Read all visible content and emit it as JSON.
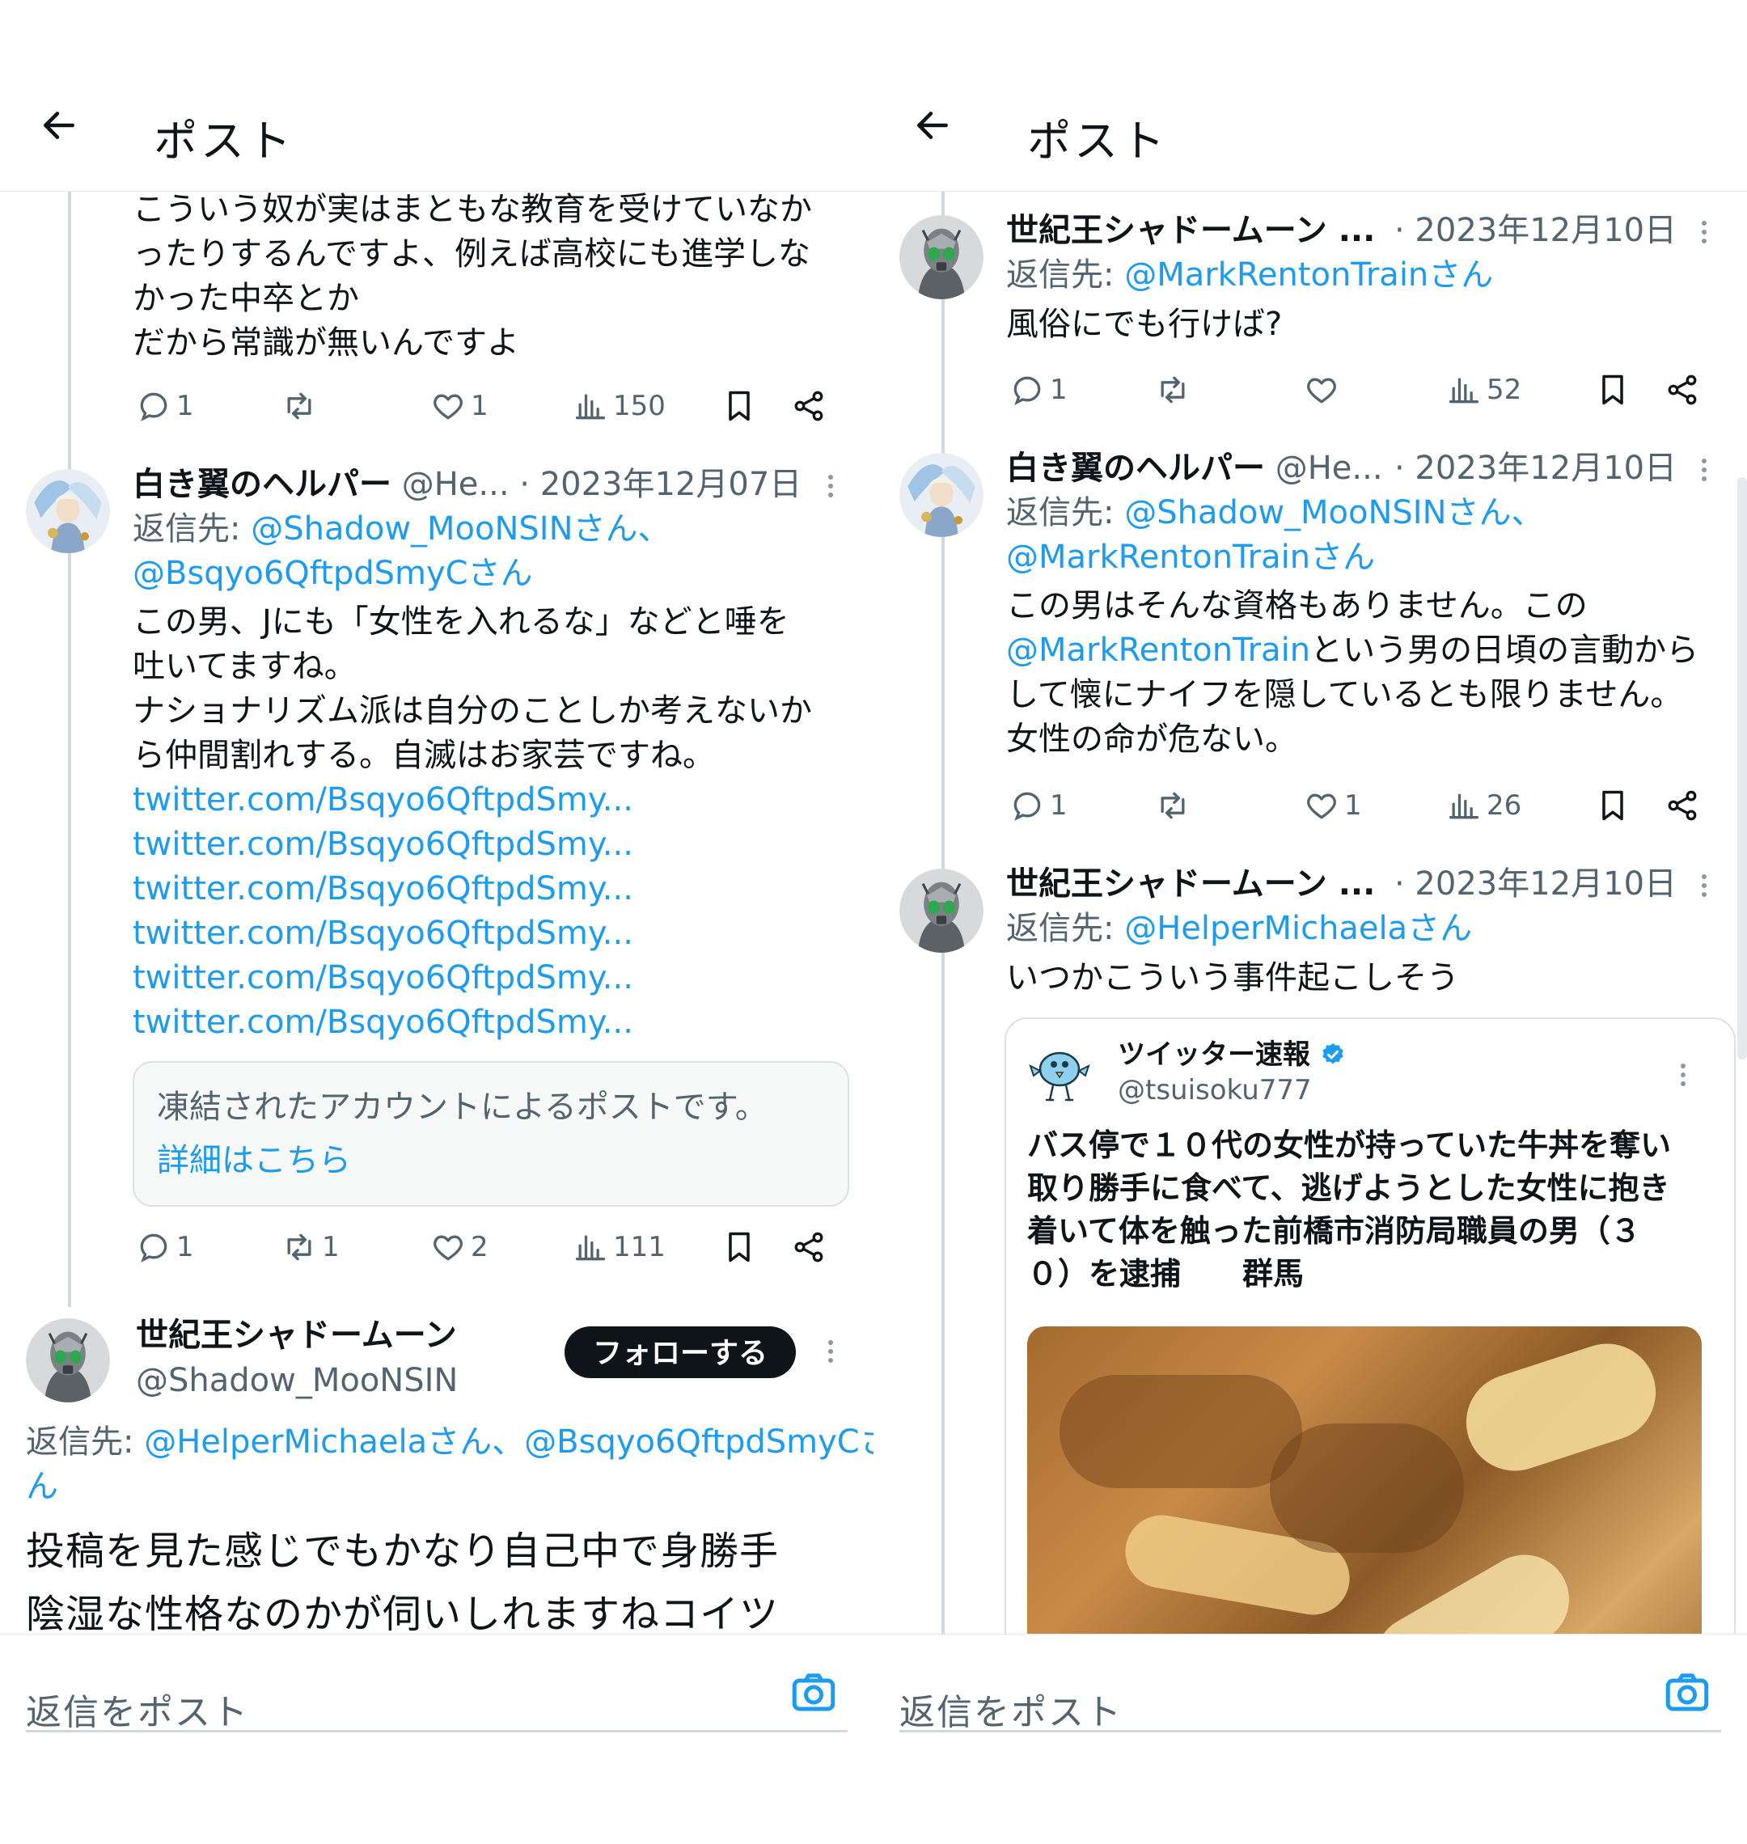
{
  "left": {
    "header": {
      "title": "ポスト"
    },
    "top_text": [
      "こういう奴が実はまともな教育を受けていなか",
      "ったりするんですよ、例えば高校にも進学しな",
      "かった中卒とか",
      "だから常識が無いんですよ"
    ],
    "top_actions": {
      "replies": "1",
      "reposts": "",
      "likes": "1",
      "views": "150"
    },
    "post2": {
      "name": "白き翼のヘルパー",
      "handle": "@He...",
      "date": "· 2023年12月07日",
      "reply_prefix": "返信先: ",
      "reply_to_1": "@Shadow_MooNSINさん、",
      "reply_to_2": "@Bsqyo6QftpdSmyCさん",
      "text": [
        "この男、Jにも「女性を入れるな」などと唾を",
        "吐いてますね。",
        "ナショナリズム派は自分のことしか考えないか",
        "ら仲間割れする。自滅はお家芸ですね。"
      ],
      "links": [
        "twitter.com/Bsqyo6QftpdSmy...",
        "twitter.com/Bsqyo6QftpdSmy...",
        "twitter.com/Bsqyo6QftpdSmy...",
        "twitter.com/Bsqyo6QftpdSmy...",
        "twitter.com/Bsqyo6QftpdSmy...",
        "twitter.com/Bsqyo6QftpdSmy..."
      ],
      "frozen_notice": "凍結されたアカウントによるポストです。",
      "frozen_link": "詳細はこちら",
      "actions": {
        "replies": "1",
        "reposts": "1",
        "likes": "2",
        "views": "111"
      }
    },
    "main_post": {
      "name": "世紀王シャドームーン",
      "handle": "@Shadow_MooNSIN",
      "follow": "フォローする",
      "reply_prefix": "返信先: ",
      "reply_to": "@HelperMichaelaさん、@Bsqyo6QftpdSmyCさ",
      "reply_to_wrap": "ん",
      "text": [
        "投稿を見た感じでもかなり自己中で身勝手",
        "陰湿な性格なのかが伺いしれますねコイツ"
      ]
    },
    "reply_placeholder": "返信をポスト"
  },
  "right": {
    "header": {
      "title": "ポスト"
    },
    "post1": {
      "name": "世紀王シャドームーン ...",
      "date": "· 2023年12月10日",
      "reply_prefix": "返信先: ",
      "reply_to": "@MarkRentonTrainさん",
      "text": "風俗にでも行けば?",
      "actions": {
        "replies": "1",
        "reposts": "",
        "likes": "",
        "views": "52"
      }
    },
    "post2": {
      "name": "白き翼のヘルパー",
      "handle": "@He...",
      "date": "· 2023年12月10日",
      "reply_prefix": "返信先: ",
      "reply_to_1": "@Shadow_MooNSINさん、",
      "reply_to_2": "@MarkRentonTrainさん",
      "text_1": "この男はそんな資格もありません。この",
      "text_mention": "@MarkRentonTrain",
      "text_2": "という男の日頃の言動から",
      "text_3": "して懐にナイフを隠しているとも限りません。",
      "text_4": "女性の命が危ない。",
      "actions": {
        "replies": "1",
        "reposts": "",
        "likes": "1",
        "views": "26"
      }
    },
    "post3": {
      "name": "世紀王シャドームーン ...",
      "date": "· 2023年12月10日",
      "reply_prefix": "返信先: ",
      "reply_to": "@HelperMichaelaさん",
      "text": "いつかこういう事件起こしそう"
    },
    "quote": {
      "name": "ツイッター速報",
      "handle": "@tsuisoku777",
      "text": [
        "バス停で１０代の女性が持っていた牛丼を奪い",
        "取り勝手に食べて、逃げようとした女性に抱き",
        "着いて体を触った前橋市消防局職員の男（３",
        "０）を逮捕　　群馬"
      ]
    },
    "reply_placeholder": "返信をポスト"
  },
  "colors": {
    "link": "#1d9bf0",
    "secondary": "#536471",
    "text": "#0f1419",
    "verified": "#1d9bf0"
  },
  "icons": [
    "back-arrow-icon",
    "reply-icon",
    "repost-icon",
    "like-icon",
    "views-icon",
    "bookmark-icon",
    "share-icon",
    "more-icon",
    "camera-icon",
    "verified-badge-icon"
  ]
}
